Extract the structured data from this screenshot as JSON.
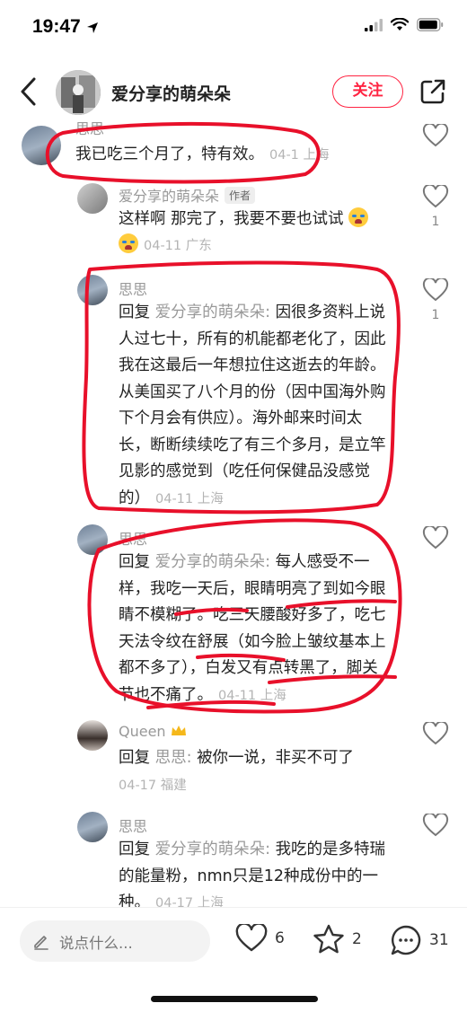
{
  "status": {
    "time": "19:47"
  },
  "header": {
    "author_name": "爱分享的萌朵朵",
    "follow_label": "关注"
  },
  "comments": [
    {
      "name": "思思",
      "text": "我已吃三个月了，特有效。",
      "meta": "04-1 上海"
    },
    {
      "name": "爱分享的萌朵朵",
      "author_tag": "作者",
      "text": "这样啊 那完了，我要不要也试试",
      "meta": "04-11 广东",
      "likes": "1"
    },
    {
      "name": "思思",
      "reply_prefix": "回复",
      "reply_to": "爱分享的萌朵朵:",
      "text": "因很多资料上说人过七十，所有的机能都老化了，因此我在这最后一年想拉住这逝去的年龄。从美国买了八个月的份（因中国海外购下个月会有供应）。海外邮来时间太长，断断续续吃了有三个多月，是立竿见影的感觉到（吃任何保健品没感觉的）",
      "meta": "04-11 上海",
      "likes": "1"
    },
    {
      "name": "思思",
      "reply_prefix": "回复",
      "reply_to": "爱分享的萌朵朵:",
      "text": "每人感受不一样，我吃一天后，眼睛明亮了到如今眼睛不模糊了。吃三天腰酸好多了，吃七天法令纹在舒展（如今脸上皱纹基本上都不多了），白发又有点转黑了，脚关节也不痛了。",
      "meta": "04-11 上海"
    },
    {
      "name": "Queen",
      "reply_prefix": "回复",
      "reply_to": "思思:",
      "text": "被你一说，非买不可了",
      "meta": "04-17 福建"
    },
    {
      "name": "思思",
      "reply_prefix": "回复",
      "reply_to": "爱分享的萌朵朵:",
      "text": "我吃的是多特瑞的能量粉，nmn只是12种成份中的一种。",
      "meta": "04-17 上海"
    }
  ],
  "bottom": {
    "input_placeholder": "说点什么...",
    "likes": "6",
    "favorites": "2",
    "comments": "31"
  },
  "colors": {
    "accent": "#ff2442",
    "annotation": "#e8102a"
  }
}
